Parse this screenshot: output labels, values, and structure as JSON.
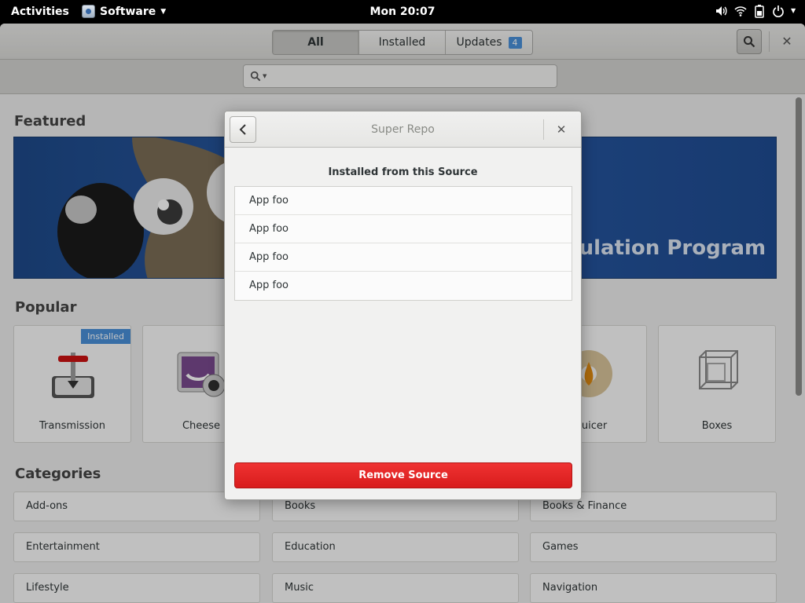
{
  "topbar": {
    "activities": "Activities",
    "app_name": "Software",
    "clock": "Mon 20:07",
    "icons": [
      "volume-icon",
      "wifi-icon",
      "battery-icon",
      "power-icon"
    ]
  },
  "headerbar": {
    "tabs": [
      {
        "label": "All",
        "active": true
      },
      {
        "label": "Installed",
        "active": false
      },
      {
        "label": "Updates",
        "active": false,
        "badge": "4"
      }
    ]
  },
  "search": {
    "placeholder": ""
  },
  "featured": {
    "title": "Featured",
    "banner_text": "pulation Program"
  },
  "popular": {
    "title": "Popular",
    "apps": [
      {
        "name": "Transmission",
        "badge": "Installed"
      },
      {
        "name": "Cheese"
      },
      {
        "name": "d Juicer"
      },
      {
        "name": "Boxes"
      }
    ]
  },
  "categories": {
    "title": "Categories",
    "items": [
      "Add-ons",
      "Books",
      "Books & Finance",
      "Entertainment",
      "Education",
      "Games",
      "Lifestyle",
      "Music",
      "Navigation"
    ]
  },
  "dialog": {
    "title": "Super Repo",
    "heading": "Installed from this Source",
    "apps": [
      "App foo",
      "App foo",
      "App foo",
      "App foo"
    ],
    "remove_label": "Remove Source"
  },
  "colors": {
    "accent": "#4a90d9",
    "destructive": "#e02424",
    "dim_overlay": "rgba(0,0,0,0.23)"
  }
}
